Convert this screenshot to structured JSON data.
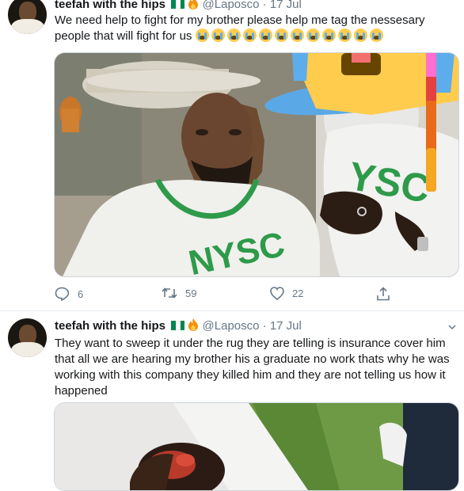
{
  "tweets": [
    {
      "name": "teefah with the hips",
      "handle": "@Laposco",
      "separator": "·",
      "date": "17 Jul",
      "text": "We need help to fight for my brother please help me tag the nessesary people that will fight for us",
      "emoji_icon": "loudly-crying-face-icon",
      "emoji_count": 12,
      "media_icons": [
        "nysc-shirt",
        "face-with-tears-emoji-sticker"
      ],
      "replies": "6",
      "retweets": "59",
      "likes": "22"
    },
    {
      "name": "teefah with the hips",
      "handle": "@Laposco",
      "separator": "·",
      "date": "17 Jul",
      "text": "They want to sweep it under the rug they are telling is insurance cover him that all we are hearing my brother his a graduate   no work thats why he was working with this company they killed him and they are not telling us how it happened"
    }
  ],
  "colors": {
    "secondary": "#657786",
    "border": "#e6ecf0",
    "nysc_green": "#2e9a4a",
    "flag_green": "#008751"
  }
}
